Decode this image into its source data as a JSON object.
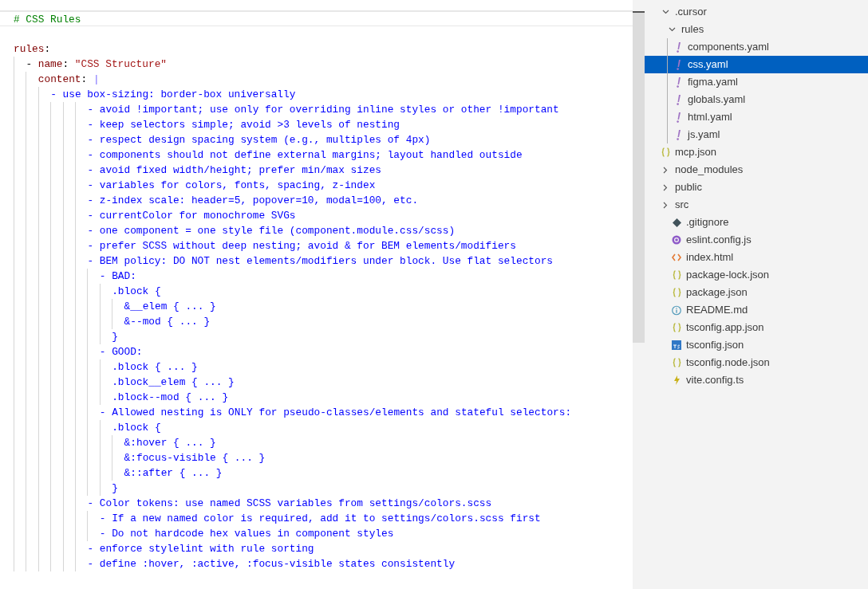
{
  "editor": {
    "lines": [
      {
        "kind": "code",
        "current": true,
        "tokens": [
          {
            "kind": "comment",
            "text": "# CSS Rules"
          }
        ]
      },
      {
        "kind": "blank",
        "current": false
      },
      {
        "kind": "code",
        "current": false,
        "tokens": [
          {
            "kind": "key",
            "text": "rules"
          },
          {
            "kind": "plain",
            "text": ":"
          }
        ]
      },
      {
        "kind": "code",
        "current": false,
        "tokens": [
          {
            "kind": "plain",
            "text": "  - "
          },
          {
            "kind": "key",
            "text": "name"
          },
          {
            "kind": "plain",
            "text": ": "
          },
          {
            "kind": "string",
            "text": "\"CSS Structure\""
          }
        ]
      },
      {
        "kind": "code",
        "current": false,
        "tokens": [
          {
            "kind": "key",
            "text": "    content"
          },
          {
            "kind": "plain",
            "text": ": "
          },
          {
            "kind": "indicator",
            "text": "|"
          }
        ]
      },
      {
        "kind": "code",
        "current": false,
        "tokens": [
          {
            "kind": "block",
            "text": "      - use box-sizing: border-box universally"
          }
        ]
      },
      {
        "kind": "code",
        "current": false,
        "tokens": [
          {
            "kind": "block",
            "text": "            - avoid !important; use only for overriding inline styles or other !important"
          }
        ]
      },
      {
        "kind": "code",
        "current": false,
        "tokens": [
          {
            "kind": "block",
            "text": "            - keep selectors simple; avoid >3 levels of nesting"
          }
        ]
      },
      {
        "kind": "code",
        "current": false,
        "tokens": [
          {
            "kind": "block",
            "text": "            - respect design spacing system (e.g., multiples of 4px)"
          }
        ]
      },
      {
        "kind": "code",
        "current": false,
        "tokens": [
          {
            "kind": "block",
            "text": "            - components should not define external margins; layout handled outside"
          }
        ]
      },
      {
        "kind": "code",
        "current": false,
        "tokens": [
          {
            "kind": "block",
            "text": "            - avoid fixed width/height; prefer min/max sizes"
          }
        ]
      },
      {
        "kind": "code",
        "current": false,
        "tokens": [
          {
            "kind": "block",
            "text": "            - variables for colors, fonts, spacing, z-index"
          }
        ]
      },
      {
        "kind": "code",
        "current": false,
        "tokens": [
          {
            "kind": "block",
            "text": "            - z-index scale: header=5, popover=10, modal=100, etc."
          }
        ]
      },
      {
        "kind": "code",
        "current": false,
        "tokens": [
          {
            "kind": "block",
            "text": "            - currentColor for monochrome SVGs"
          }
        ]
      },
      {
        "kind": "code",
        "current": false,
        "tokens": [
          {
            "kind": "block",
            "text": "            - one component = one style file (component.module.css/scss)"
          }
        ]
      },
      {
        "kind": "code",
        "current": false,
        "tokens": [
          {
            "kind": "block",
            "text": "            - prefer SCSS without deep nesting; avoid & for BEM elements/modifiers"
          }
        ]
      },
      {
        "kind": "code",
        "current": false,
        "tokens": [
          {
            "kind": "block",
            "text": "            - BEM policy: DO NOT nest elements/modifiers under block. Use flat selectors"
          }
        ]
      },
      {
        "kind": "code",
        "current": false,
        "tokens": [
          {
            "kind": "block",
            "text": "              - BAD:"
          }
        ]
      },
      {
        "kind": "code",
        "current": false,
        "tokens": [
          {
            "kind": "block",
            "text": "                .block {"
          }
        ]
      },
      {
        "kind": "code",
        "current": false,
        "tokens": [
          {
            "kind": "block",
            "text": "                  &__elem { ... }"
          }
        ]
      },
      {
        "kind": "code",
        "current": false,
        "tokens": [
          {
            "kind": "block",
            "text": "                  &--mod { ... }"
          }
        ]
      },
      {
        "kind": "code",
        "current": false,
        "tokens": [
          {
            "kind": "block",
            "text": "                }"
          }
        ]
      },
      {
        "kind": "code",
        "current": false,
        "tokens": [
          {
            "kind": "block",
            "text": "              - GOOD:"
          }
        ]
      },
      {
        "kind": "code",
        "current": false,
        "tokens": [
          {
            "kind": "block",
            "text": "                .block { ... }"
          }
        ]
      },
      {
        "kind": "code",
        "current": false,
        "tokens": [
          {
            "kind": "block",
            "text": "                .block__elem { ... }"
          }
        ]
      },
      {
        "kind": "code",
        "current": false,
        "tokens": [
          {
            "kind": "block",
            "text": "                .block--mod { ... }"
          }
        ]
      },
      {
        "kind": "code",
        "current": false,
        "tokens": [
          {
            "kind": "block",
            "text": "              - Allowed nesting is ONLY for pseudo-classes/elements and stateful selectors:"
          }
        ]
      },
      {
        "kind": "code",
        "current": false,
        "tokens": [
          {
            "kind": "block",
            "text": "                .block {"
          }
        ]
      },
      {
        "kind": "code",
        "current": false,
        "tokens": [
          {
            "kind": "block",
            "text": "                  &:hover { ... }"
          }
        ]
      },
      {
        "kind": "code",
        "current": false,
        "tokens": [
          {
            "kind": "block",
            "text": "                  &:focus-visible { ... }"
          }
        ]
      },
      {
        "kind": "code",
        "current": false,
        "tokens": [
          {
            "kind": "block",
            "text": "                  &::after { ... }"
          }
        ]
      },
      {
        "kind": "code",
        "current": false,
        "tokens": [
          {
            "kind": "block",
            "text": "                }"
          }
        ]
      },
      {
        "kind": "code",
        "current": false,
        "tokens": [
          {
            "kind": "block",
            "text": "            - Color tokens: use named SCSS variables from settings/colors.scss"
          }
        ]
      },
      {
        "kind": "code",
        "current": false,
        "tokens": [
          {
            "kind": "block",
            "text": "              - If a new named color is required, add it to settings/colors.scss first"
          }
        ]
      },
      {
        "kind": "code",
        "current": false,
        "tokens": [
          {
            "kind": "block",
            "text": "              - Do not hardcode hex values in component styles"
          }
        ]
      },
      {
        "kind": "code",
        "current": false,
        "tokens": [
          {
            "kind": "block",
            "text": "            - enforce stylelint with rule sorting"
          }
        ]
      },
      {
        "kind": "code",
        "current": false,
        "tokens": [
          {
            "kind": "block",
            "text": "            - define :hover, :active, :focus-visible states consistently"
          }
        ]
      }
    ]
  },
  "explorer": {
    "items": [
      {
        "kind": "folder",
        "label": ".cursor",
        "expanded": true,
        "selected": false,
        "children": [
          {
            "kind": "folder",
            "label": "rules",
            "expanded": true,
            "selected": false,
            "children": [
              {
                "kind": "yaml",
                "label": "components.yaml",
                "selected": false
              },
              {
                "kind": "yaml",
                "label": "css.yaml",
                "selected": true
              },
              {
                "kind": "yaml",
                "label": "figma.yaml",
                "selected": false
              },
              {
                "kind": "yaml",
                "label": "globals.yaml",
                "selected": false
              },
              {
                "kind": "yaml",
                "label": "html.yaml",
                "selected": false
              },
              {
                "kind": "yaml",
                "label": "js.yaml",
                "selected": false
              }
            ]
          },
          {
            "kind": "json",
            "label": "mcp.json",
            "selected": false
          }
        ]
      },
      {
        "kind": "folder",
        "label": "node_modules",
        "expanded": false,
        "selected": false
      },
      {
        "kind": "folder",
        "label": "public",
        "expanded": false,
        "selected": false
      },
      {
        "kind": "folder",
        "label": "src",
        "expanded": false,
        "selected": false
      },
      {
        "kind": "git",
        "label": ".gitignore",
        "selected": false
      },
      {
        "kind": "eslint",
        "label": "eslint.config.js",
        "selected": false
      },
      {
        "kind": "html",
        "label": "index.html",
        "selected": false
      },
      {
        "kind": "json",
        "label": "package-lock.json",
        "selected": false
      },
      {
        "kind": "json",
        "label": "package.json",
        "selected": false
      },
      {
        "kind": "info",
        "label": "README.md",
        "selected": false
      },
      {
        "kind": "json",
        "label": "tsconfig.app.json",
        "selected": false
      },
      {
        "kind": "ts",
        "label": "tsconfig.json",
        "selected": false
      },
      {
        "kind": "json",
        "label": "tsconfig.node.json",
        "selected": false
      },
      {
        "kind": "vite",
        "label": "vite.config.ts",
        "selected": false
      }
    ]
  }
}
